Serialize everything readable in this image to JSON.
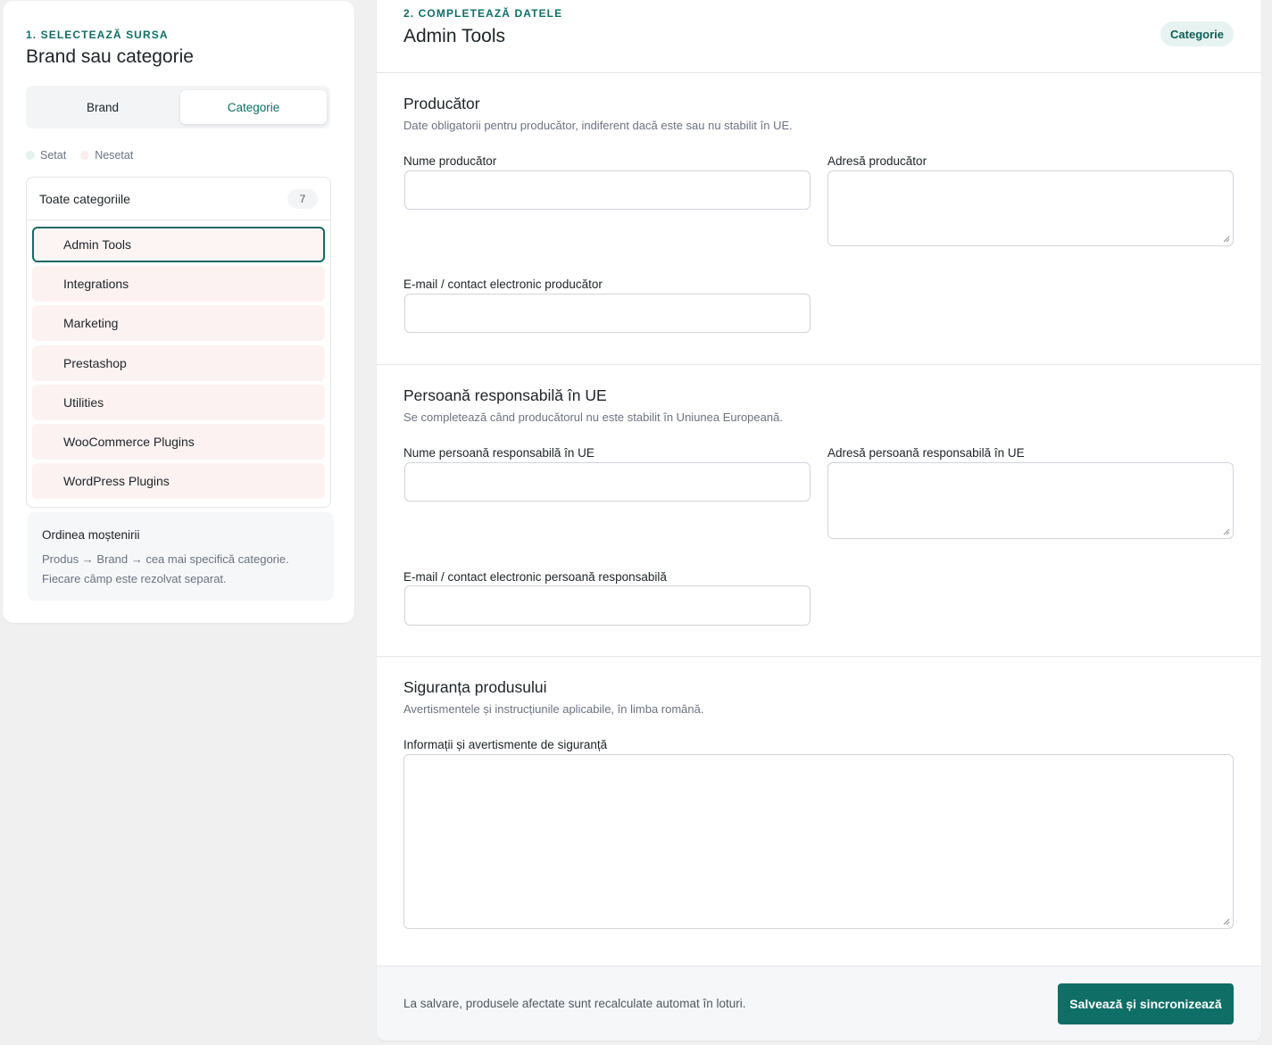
{
  "source": {
    "step_label": "1. SELECTEAZĂ SURSA",
    "title": "Brand sau categorie",
    "segment": {
      "brand": "Brand",
      "category": "Categorie",
      "selected": "Categorie"
    },
    "legend": {
      "set": "Setat",
      "unset": "Nesetat"
    },
    "all_categories": {
      "label": "Toate categoriile",
      "count": "7"
    },
    "categories": [
      {
        "label": "Admin Tools",
        "active": true
      },
      {
        "label": "Integrations",
        "active": false
      },
      {
        "label": "Marketing",
        "active": false
      },
      {
        "label": "Prestashop",
        "active": false
      },
      {
        "label": "Utilities",
        "active": false
      },
      {
        "label": "WooCommerce Plugins",
        "active": false
      },
      {
        "label": "WordPress Plugins",
        "active": false
      }
    ],
    "inheritance": {
      "title": "Ordinea moștenirii",
      "line1": "Produs → Brand → cea mai specifică categorie.",
      "line2": "Fiecare câmp este rezolvat separat."
    }
  },
  "form": {
    "step_label": "2. COMPLETEAZĂ DATELE",
    "title": "Admin Tools",
    "badge": "Categorie",
    "producer": {
      "title": "Producător",
      "subtitle": "Date obligatorii pentru producător, indiferent dacă este sau nu stabilit în UE.",
      "name_label": "Nume producător",
      "name_value": "",
      "address_label": "Adresă producător",
      "address_value": "",
      "email_label": "E-mail / contact electronic producător",
      "email_value": ""
    },
    "responsible": {
      "title": "Persoană responsabilă în UE",
      "subtitle": "Se completează când producătorul nu este stabilit în Uniunea Europeană.",
      "name_label": "Nume persoană responsabilă în UE",
      "name_value": "",
      "address_label": "Adresă persoană responsabilă în UE",
      "address_value": "",
      "email_label": "E-mail / contact electronic persoană responsabilă",
      "email_value": ""
    },
    "safety": {
      "title": "Siguranța produsului",
      "subtitle": "Avertismentele și instrucțiunile aplicabile, în limba română.",
      "info_label": "Informații și avertismente de siguranță",
      "info_value": ""
    },
    "footer": {
      "note": "La salvare, produsele afectate sunt recalculate automat în loturi.",
      "save_label": "Salvează și sincronizează"
    }
  },
  "colors": {
    "accent": "#0f6e66",
    "set": "#e3f2ee",
    "unset": "#fdecec"
  }
}
